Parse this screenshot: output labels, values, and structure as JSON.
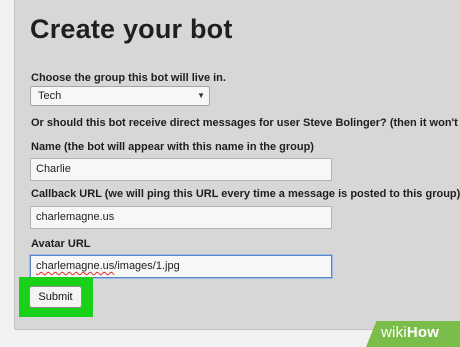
{
  "page": {
    "title": "Create your bot"
  },
  "form": {
    "group_label": "Choose the group this bot will live in.",
    "group_selected": "Tech",
    "direct_messages_label": "Or should this bot receive direct messages for user Steve Bolinger? (then it won't list",
    "name_label": "Name (the bot will appear with this name in the group)",
    "name_value": "Charlie",
    "callback_label": "Callback URL (we will ping this URL every time a message is posted to this group)",
    "callback_value": "charlemagne.us",
    "avatar_label": "Avatar URL",
    "avatar_value_underlined": "charlemagne.us",
    "avatar_value_rest": "/images/1.jpg",
    "submit_label": "Submit"
  },
  "watermark": {
    "part1": "wiki",
    "part2": "How"
  },
  "icons": {
    "select_caret": "chevron-down-icon"
  },
  "colors": {
    "highlight": "#1ad11a",
    "focus_border": "#5a86c7",
    "panel_bg": "#d7d7d7",
    "watermark_bg": "#7bbd4a"
  }
}
